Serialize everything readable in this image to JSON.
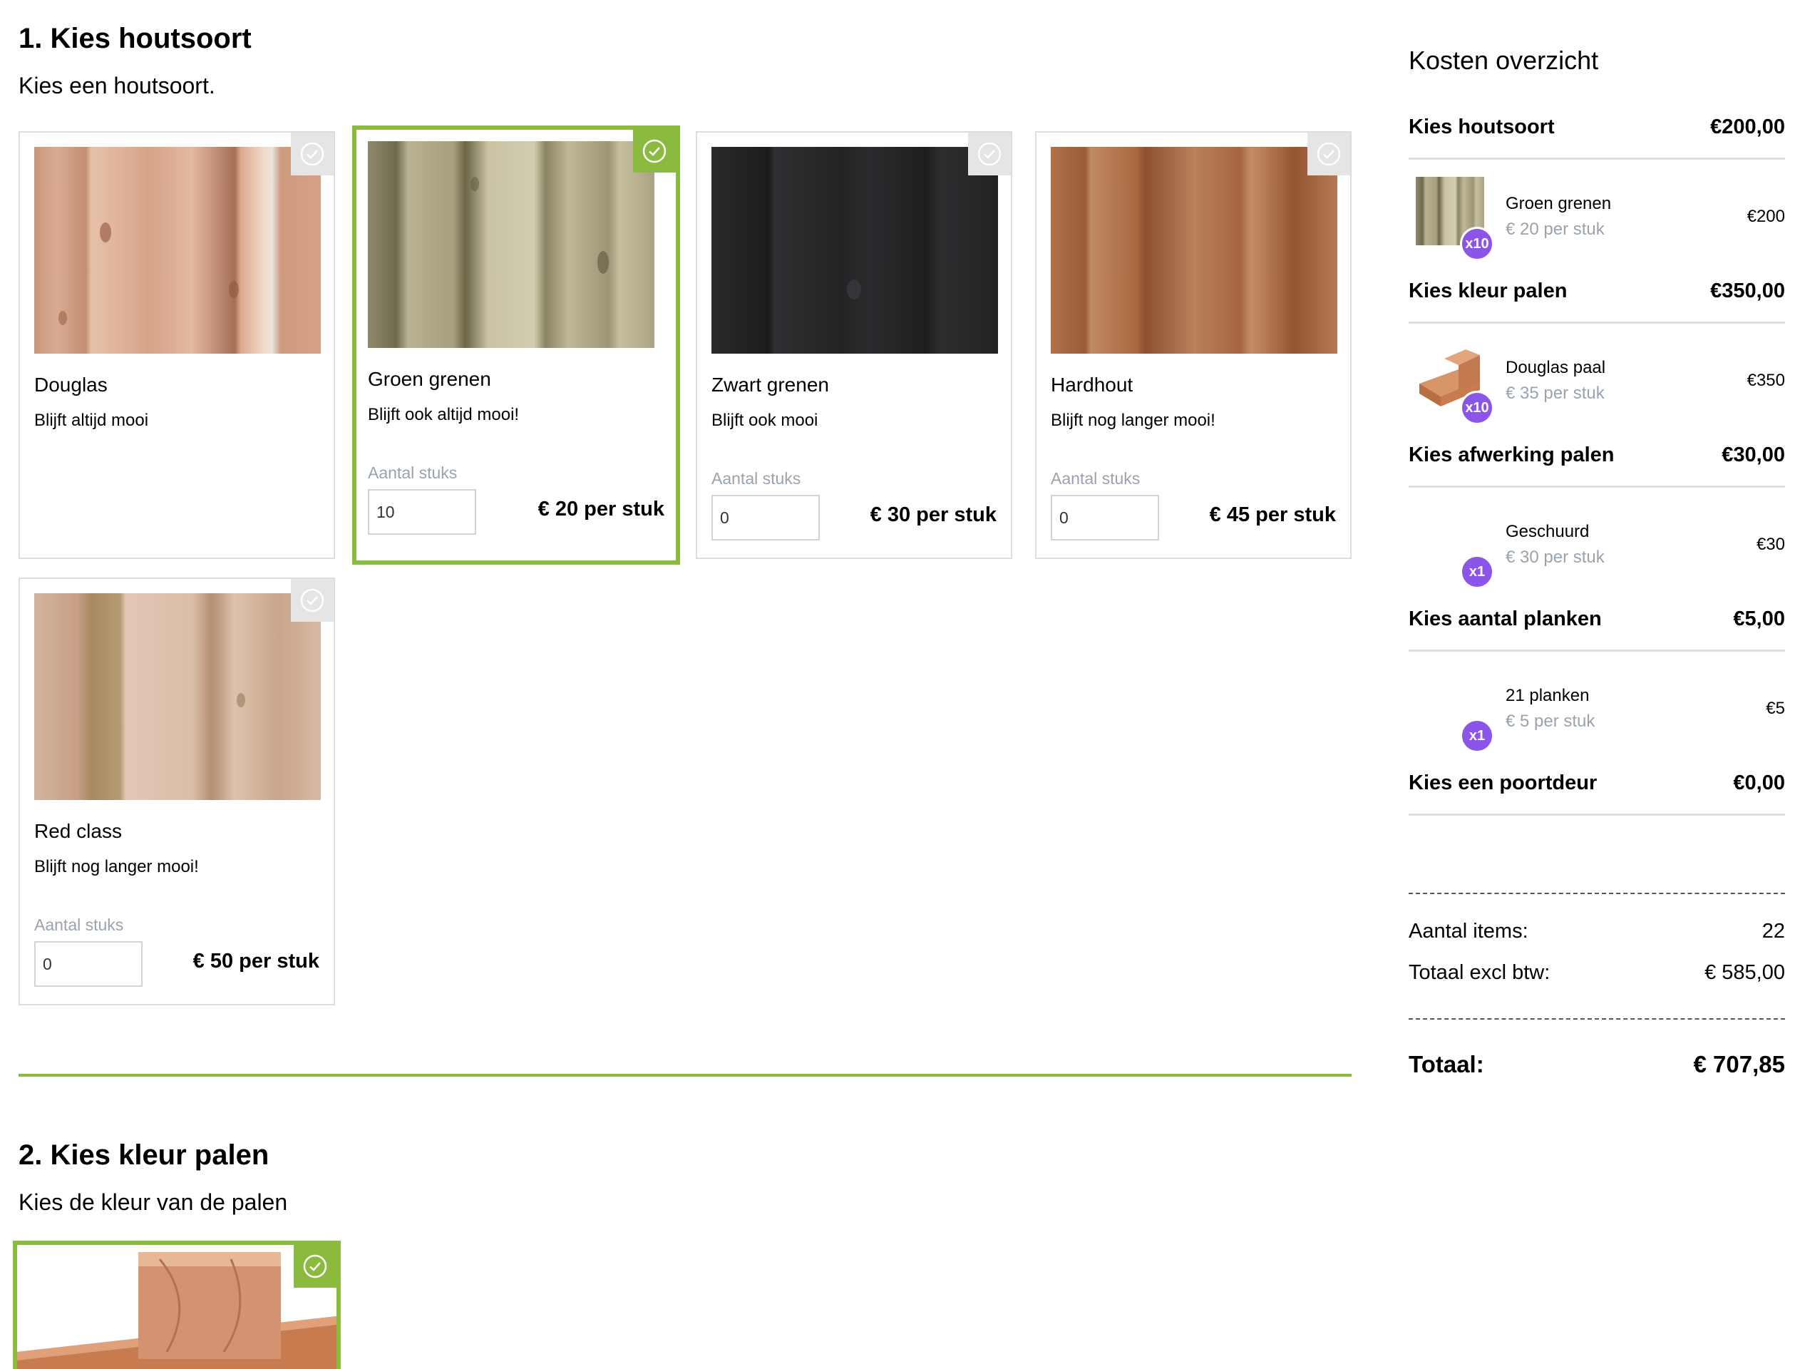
{
  "step1": {
    "title": "1. Kies houtsoort",
    "subtitle": "Kies een houtsoort.",
    "qty_label": "Aantal stuks",
    "products": [
      {
        "name": "Douglas",
        "desc": "Blijft altijd mooi",
        "qty": "",
        "price": "",
        "selected": false,
        "wood": "douglas"
      },
      {
        "name": "Groen grenen",
        "desc": "Blijft ook altijd mooi!",
        "qty": "10",
        "price": "€ 20 per stuk",
        "selected": true,
        "wood": "groen"
      },
      {
        "name": "Zwart grenen",
        "desc": "Blijft ook mooi",
        "qty": "0",
        "price": "€ 30 per stuk",
        "selected": false,
        "wood": "zwart"
      },
      {
        "name": "Hardhout",
        "desc": "Blijft nog langer mooi!",
        "qty": "0",
        "price": "€ 45 per stuk",
        "selected": false,
        "wood": "hardhout"
      },
      {
        "name": "Red class",
        "desc": "Blijft nog langer mooi!",
        "qty": "0",
        "price": "€ 50 per stuk",
        "selected": false,
        "wood": "red"
      }
    ]
  },
  "step2": {
    "title": "2. Kies kleur palen",
    "subtitle": "Kies de kleur van de palen"
  },
  "summary": {
    "title": "Kosten overzicht",
    "sections": [
      {
        "label": "Kies houtsoort",
        "amount": "€200,00",
        "item": {
          "name": "Groen grenen",
          "unit": "€ 20 per stuk",
          "total": "€200",
          "badge": "x10",
          "thumb": "groen"
        }
      },
      {
        "label": "Kies kleur palen",
        "amount": "€350,00",
        "item": {
          "name": "Douglas paal",
          "unit": "€ 35 per stuk",
          "total": "€350",
          "badge": "x10",
          "thumb": "paal"
        }
      },
      {
        "label": "Kies afwerking palen",
        "amount": "€30,00",
        "item": {
          "name": "Geschuurd",
          "unit": "€ 30 per stuk",
          "total": "€30",
          "badge": "x1",
          "thumb": "none"
        }
      },
      {
        "label": "Kies aantal planken",
        "amount": "€5,00",
        "item": {
          "name": "21 planken",
          "unit": "€ 5 per stuk",
          "total": "€5",
          "badge": "x1",
          "thumb": "none"
        }
      },
      {
        "label": "Kies een poortdeur",
        "amount": "€0,00"
      }
    ],
    "items_label": "Aantal items:",
    "items_value": "22",
    "excl_label": "Totaal excl btw:",
    "excl_value": "€ 585,00",
    "total_label": "Totaal:",
    "total_value": "€ 707,85"
  },
  "colors": {
    "accent": "#8bbb3e",
    "badge": "#8a55e8",
    "muted": "#9aa3ad"
  }
}
